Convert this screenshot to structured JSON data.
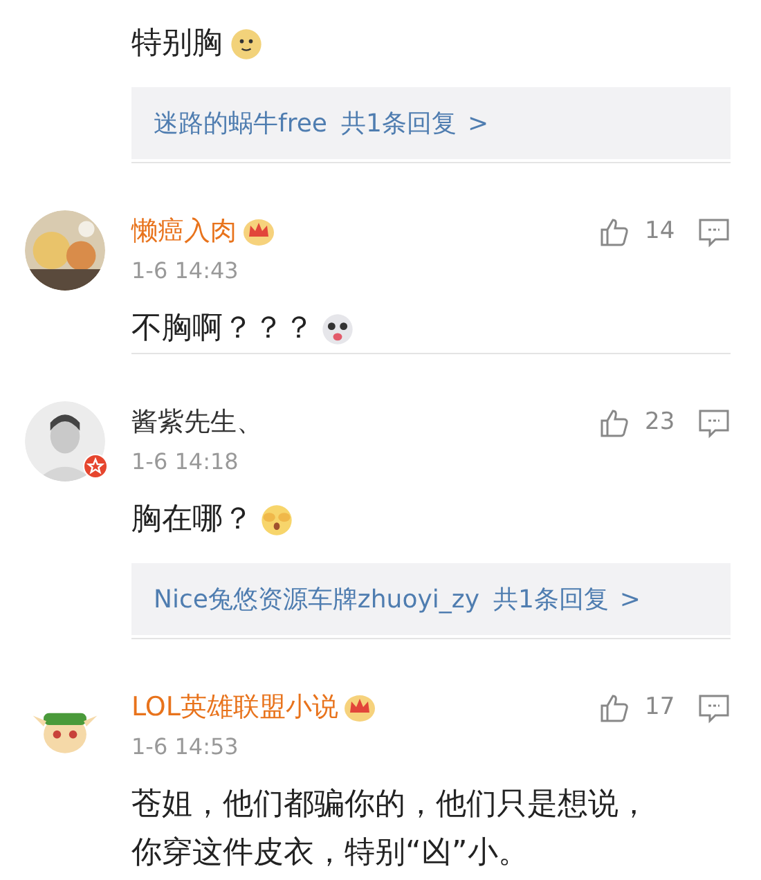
{
  "comments": [
    {
      "lines": [
        "特别胸"
      ],
      "emoji": true,
      "reply": {
        "user": "迷路的蜗牛free",
        "count": "共1条回复",
        "arrow": ">"
      }
    },
    {
      "name": "懒癌入肉",
      "vip": true,
      "verified": false,
      "time": "1-6 14:43",
      "likes": "14",
      "lines": [
        "不胸啊？？？"
      ],
      "emoji": true
    },
    {
      "name": "酱紫先生、",
      "vip": false,
      "verified": true,
      "time": "1-6 14:18",
      "likes": "23",
      "lines": [
        "胸在哪？"
      ],
      "emoji": true,
      "reply": {
        "user": "Nice兔悠资源车牌zhuoyi_zy",
        "count": "共1条回复",
        "arrow": ">"
      }
    },
    {
      "name": "LOL英雄联盟小说",
      "vip": true,
      "verified": false,
      "time": "1-6 14:53",
      "likes": "17",
      "lines": [
        "苍姐，他们都骗你的，他们只是想说，",
        "你穿这件皮衣，特别“凶”小。"
      ],
      "emoji": false
    }
  ]
}
